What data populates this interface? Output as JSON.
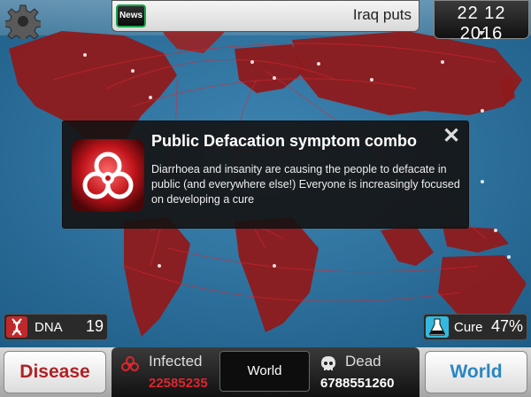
{
  "top_bar": {
    "news_label": "News",
    "ticker_text": "Iraq puts",
    "date": "22 12 2016"
  },
  "popup": {
    "title": "Public Defacation symptom combo",
    "body": "Diarrhoea and insanity are causing the people to defacate in public (and everywhere else!) Everyone is increasingly focused on developing a cure",
    "close_glyph": "✕"
  },
  "dna": {
    "label": "DNA",
    "value": "19"
  },
  "cure": {
    "label": "Cure",
    "value": "47%"
  },
  "bottom_bar": {
    "disease_label": "Disease",
    "world_label": "World",
    "infected_label": "Infected",
    "infected_value": "22585235",
    "region_label": "World",
    "dead_label": "Dead",
    "dead_value": "6788551260"
  },
  "colors": {
    "ocean": "#2b6e9a",
    "land_infected": "#8e1a1c",
    "infected_red": "#e0252c",
    "disease_red": "#b22024",
    "world_blue": "#2a86c0",
    "cure_cyan": "#35b8df"
  },
  "icons": {
    "settings": "gear-icon",
    "close": "close-icon",
    "popup": "biohazard-icon",
    "dna": "dna-icon",
    "cure": "flask-icon",
    "infected": "biohazard-icon",
    "dead": "skull-icon"
  }
}
